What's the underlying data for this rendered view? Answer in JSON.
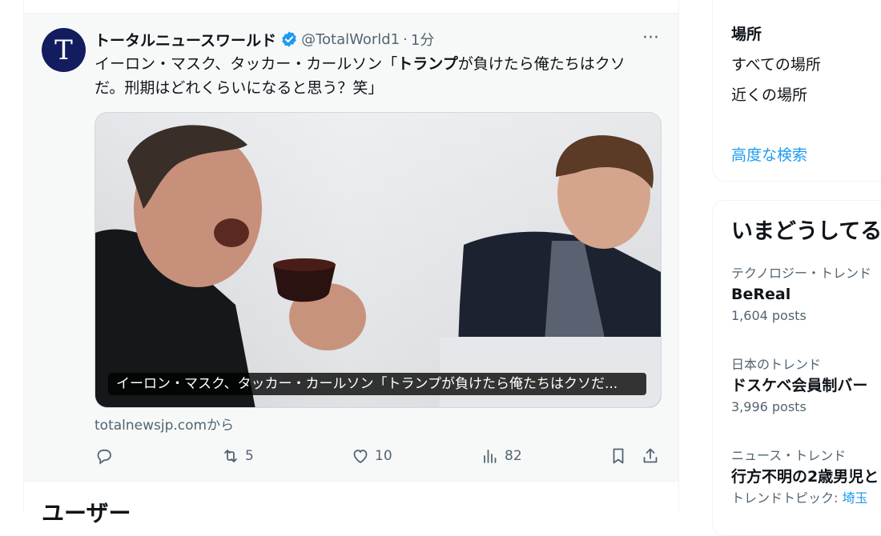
{
  "tweet": {
    "avatar_letter": "T",
    "name": "トータルニュースワールド",
    "handle": "@TotalWorld1",
    "separator": "·",
    "time": "1分",
    "more": "···",
    "text_before": "イーロン・マスク、タッカー・カールソン「",
    "text_bold": "トランプ",
    "text_after": "が負けたら俺たちはクソだ。刑期はどれくらいになると思う？笑」",
    "media_caption": "イーロン・マスク、タッカー・カールソン「トランプが負けたら俺たちはクソだ...",
    "source": "totalnewsjp.comから",
    "actions": {
      "reply_count": "",
      "retweet_count": "5",
      "like_count": "10",
      "views_count": "82"
    },
    "colors": {
      "verified": "#1d9bf0",
      "avatar_bg": "#121c5e"
    }
  },
  "next_section": {
    "title": "ユーザー"
  },
  "sidebar": {
    "location": {
      "heading": "場所",
      "options": [
        "すべての場所",
        "近くの場所"
      ],
      "advanced_search": "高度な検索"
    },
    "trends": {
      "title": "いまどうしてる？",
      "items": [
        {
          "meta": "テクノロジー・トレンド",
          "name": "BeReal",
          "posts": "1,604 posts"
        },
        {
          "meta": "日本のトレンド",
          "name": "ドスケベ会員制バー",
          "posts": "3,996 posts"
        },
        {
          "meta": "ニュース・トレンド",
          "name": "行方不明の2歳男児と",
          "posts_prefix": "トレンドトピック: ",
          "posts_link": "埼玉"
        }
      ]
    }
  }
}
